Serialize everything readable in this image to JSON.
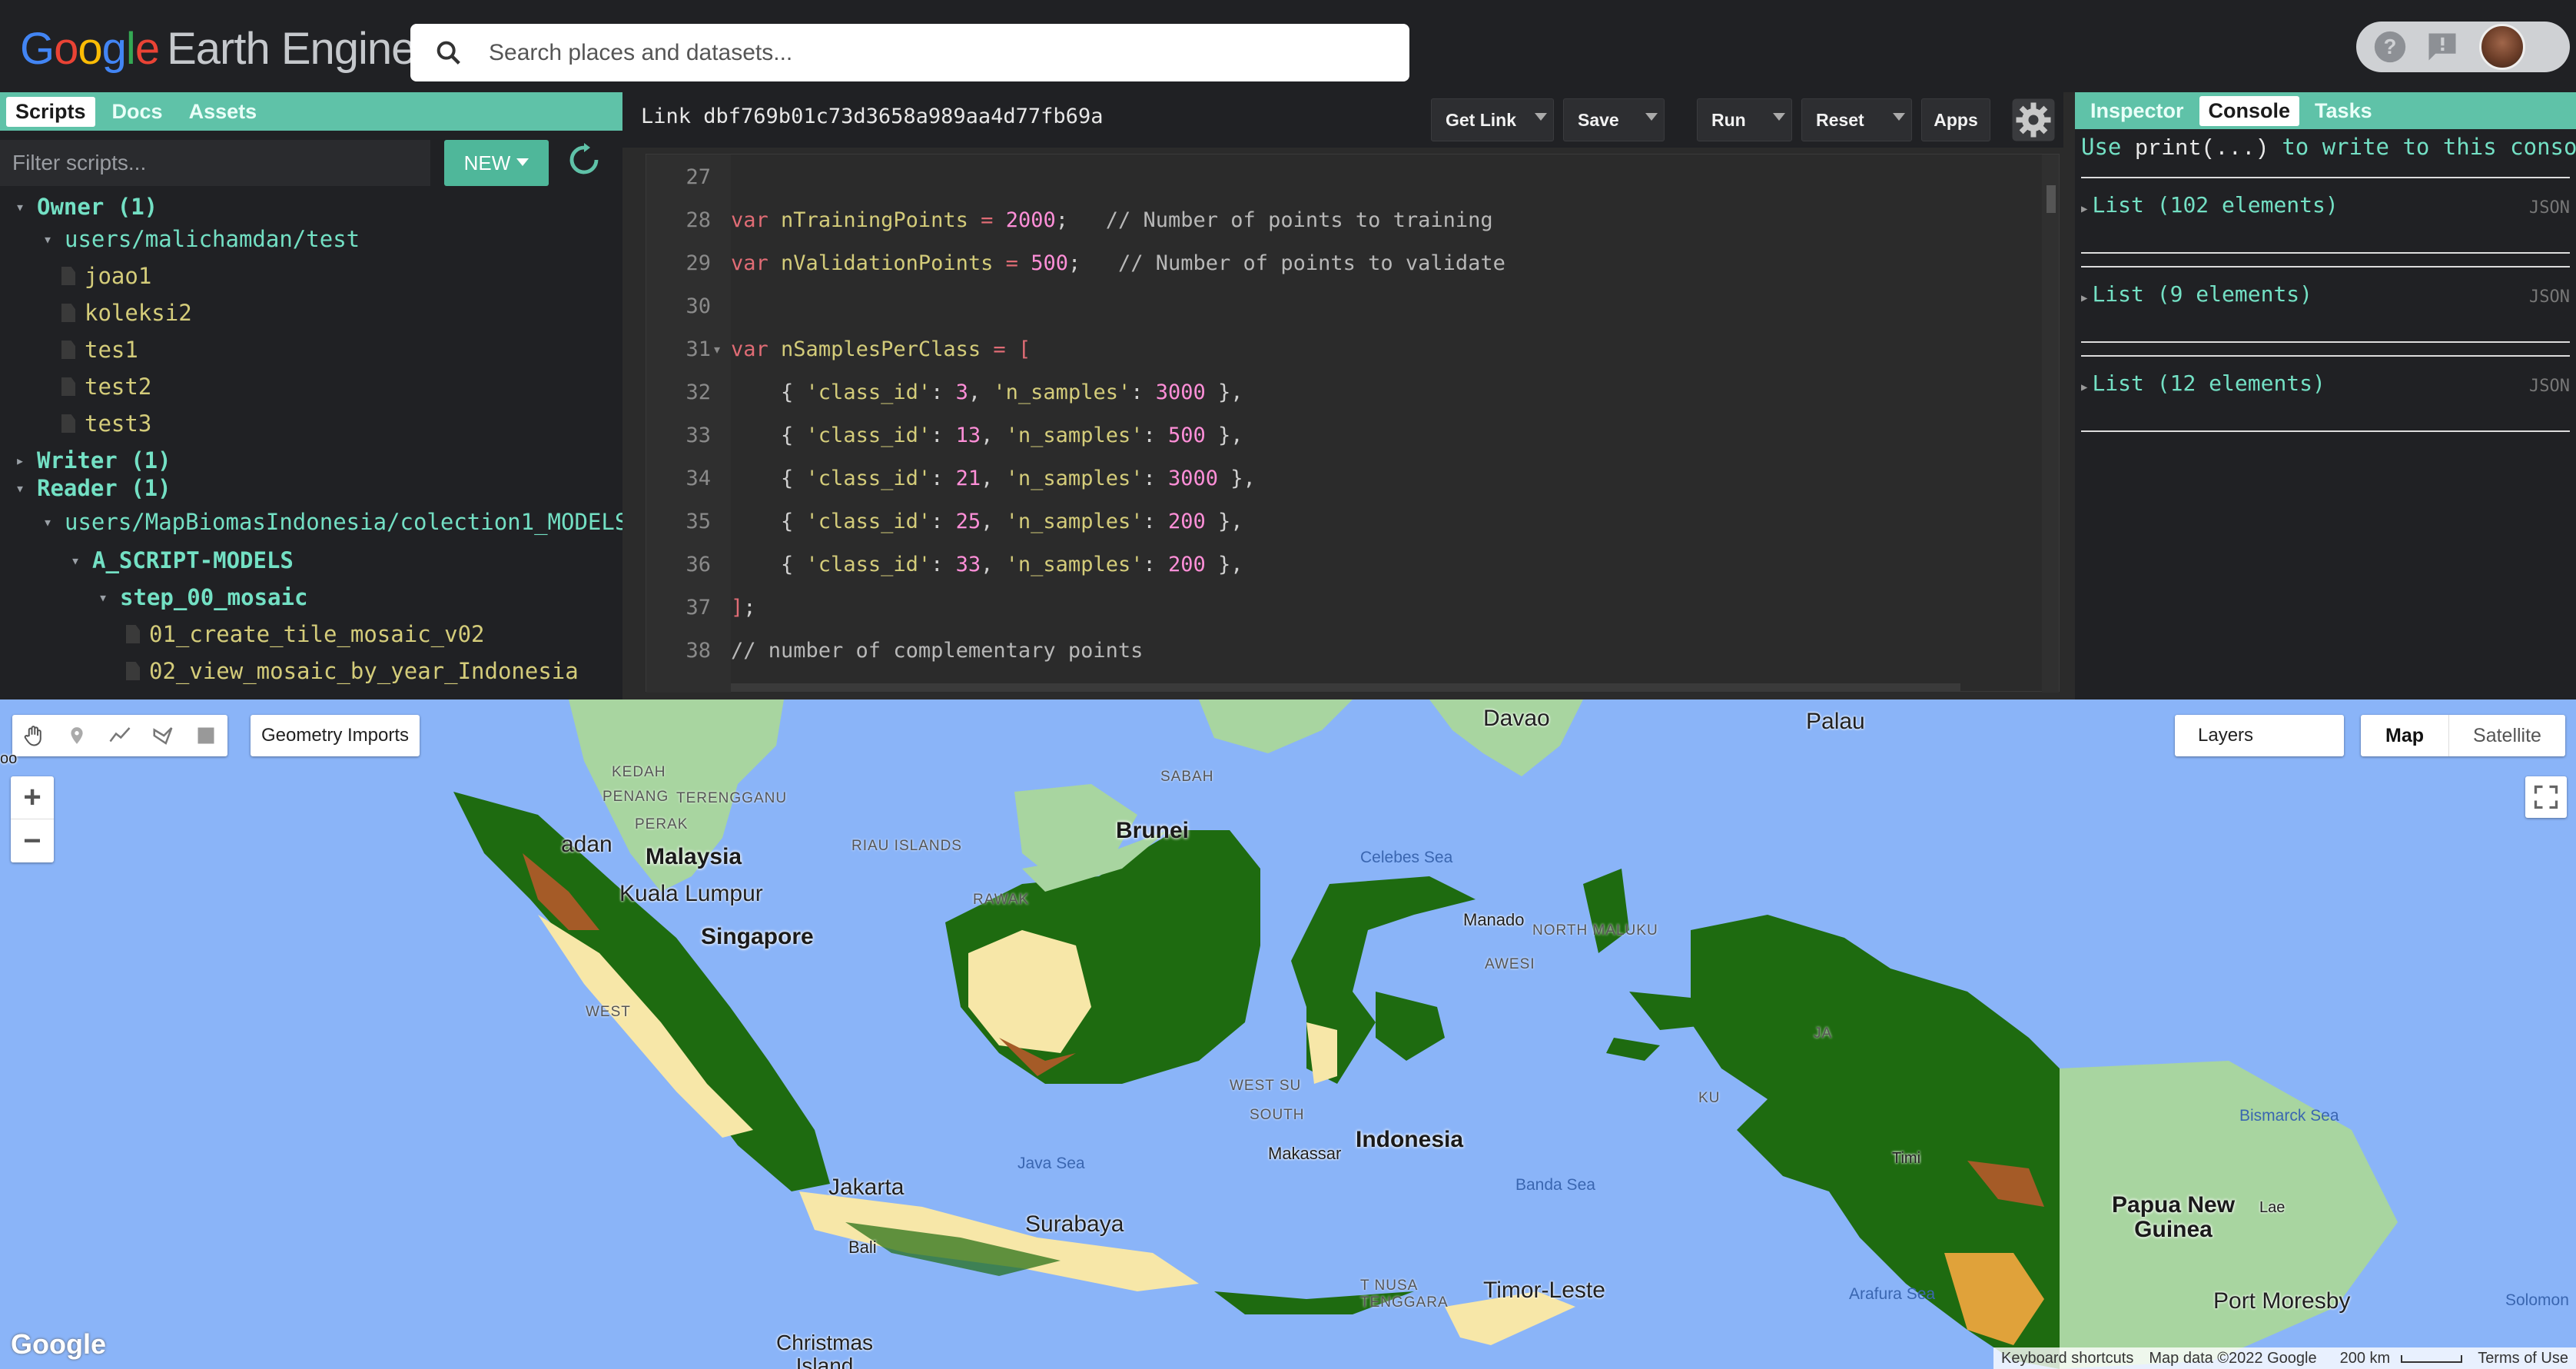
{
  "header": {
    "logo_google": [
      "G",
      "o",
      "o",
      "g",
      "l",
      "e"
    ],
    "logo_product": "Earth Engine",
    "search_placeholder": "Search places and datasets...",
    "icons": [
      "search-icon",
      "help-icon",
      "feedback-icon",
      "avatar"
    ]
  },
  "left_panel": {
    "tabs": [
      {
        "label": "Scripts",
        "active": true
      },
      {
        "label": "Docs",
        "active": false
      },
      {
        "label": "Assets",
        "active": false
      }
    ],
    "filter_placeholder": "Filter scripts...",
    "new_label": "NEW",
    "tree": [
      {
        "label": "Owner (1)",
        "kind": "group",
        "expanded": true
      },
      {
        "label": "users/malichamdan/test",
        "kind": "folder",
        "expanded": true
      },
      {
        "label": "joao1",
        "kind": "file"
      },
      {
        "label": "koleksi2",
        "kind": "file"
      },
      {
        "label": "tes1",
        "kind": "file"
      },
      {
        "label": "test2",
        "kind": "file"
      },
      {
        "label": "test3",
        "kind": "file"
      },
      {
        "label": "Writer (1)",
        "kind": "group",
        "expanded": false
      },
      {
        "label": "Reader (1)",
        "kind": "group",
        "expanded": true
      },
      {
        "label": "users/MapBiomasIndonesia/colection1_MODELS",
        "kind": "folder",
        "expanded": true
      },
      {
        "label": "A_SCRIPT-MODELS",
        "kind": "folder-bold",
        "expanded": true
      },
      {
        "label": "step_00_mosaic",
        "kind": "folder-bold",
        "expanded": true
      },
      {
        "label": "01_create_tile_mosaic_v02",
        "kind": "file"
      },
      {
        "label": "02_view_mosaic_by_year_Indonesia",
        "kind": "file"
      }
    ]
  },
  "editor": {
    "link_text": "Link dbf769b01c73d3658a989aa4d77fb69a",
    "buttons": {
      "get_link": "Get Link",
      "save": "Save",
      "run": "Run",
      "reset": "Reset",
      "apps": "Apps"
    },
    "lines": [
      {
        "n": "27",
        "text": ""
      },
      {
        "n": "28",
        "text": "var nTrainingPoints = 2000;   // Number of points to training"
      },
      {
        "n": "29",
        "text": "var nValidationPoints = 500;   // Number of points to validate"
      },
      {
        "n": "30",
        "text": ""
      },
      {
        "n": "31",
        "text": "var nSamplesPerClass = ["
      },
      {
        "n": "32",
        "text": "    { 'class_id': 3, 'n_samples': 3000 },"
      },
      {
        "n": "33",
        "text": "    { 'class_id': 13, 'n_samples': 500 },"
      },
      {
        "n": "34",
        "text": "    { 'class_id': 21, 'n_samples': 3000 },"
      },
      {
        "n": "35",
        "text": "    { 'class_id': 25, 'n_samples': 200 },"
      },
      {
        "n": "36",
        "text": "    { 'class_id': 33, 'n_samples': 200 },"
      },
      {
        "n": "37",
        "text": "];"
      },
      {
        "n": "38",
        "text": "// number of complementary points"
      }
    ]
  },
  "right_panel": {
    "tabs": [
      {
        "label": "Inspector",
        "active": false
      },
      {
        "label": "Console",
        "active": true
      },
      {
        "label": "Tasks",
        "active": false
      }
    ],
    "hint_prefix": "Use ",
    "hint_code": "print(...)",
    "hint_suffix": " to write to this console.",
    "entries": [
      {
        "label": "List (102 elements)",
        "tag": "JSON"
      },
      {
        "label": "List (9 elements)",
        "tag": "JSON"
      },
      {
        "label": "List (12 elements)",
        "tag": "JSON"
      }
    ]
  },
  "map": {
    "geometry_imports": "Geometry Imports",
    "layers": "Layers",
    "map_type_map": "Map",
    "map_type_satellite": "Satellite",
    "zoom_in": "+",
    "zoom_out": "−",
    "google_logo": "Google",
    "footer": {
      "shortcuts": "Keyboard shortcuts",
      "data": "Map data ©2022 Google",
      "scale": "200 km",
      "terms": "Terms of Use"
    },
    "labels": {
      "davao": "Davao",
      "palau": "Palau",
      "kedah": "KEDAH",
      "sabah": "SABAH",
      "penang": "PENANG",
      "terengganu": "TERENGGANU",
      "perak": "PERAK",
      "brunei": "Brunei",
      "malaysia": "Malaysia",
      "riau": "RIAU ISLANDS",
      "celebes": "Celebes Sea",
      "kualalumpur": "Kuala Lumpur",
      "singapore": "Singapore",
      "adan": "adan",
      "rawak": "RAWAK",
      "manado": "Manado",
      "northmaluku": "NORTH MALUKU",
      "awesi": "AWESI",
      "west": "WEST",
      "westsu": "WEST SU",
      "south": "SOUTH",
      "makassar": "Makassar",
      "indonesia": "Indonesia",
      "bismarck": "Bismarck Sea",
      "java": "Java Sea",
      "banda": "Banda Sea",
      "jakarta": "Jakarta",
      "surabaya": "Surabaya",
      "papua": "Papua New\nGuinea",
      "lae": "Lae",
      "timor": "Timor-Leste",
      "arafura": "Arafura Sea",
      "portmoresby": "Port Moresby",
      "christmas": "Christmas\nIsland",
      "solomon": "Solomon",
      "nusa": "T NUSA",
      "tenggara": "TENGGARA",
      "ku": "KU",
      "ja": "JA",
      "timi": "Timi",
      "bali": "Bali",
      "oo": "oo"
    }
  },
  "colors": {
    "accent_teal": "#5fc2a8",
    "ocean": "#8ab4f8",
    "forest": "#1e6b10",
    "savanna": "#f7e7a8",
    "crop": "#a55b27",
    "land_gray": "#a8d5a0"
  }
}
